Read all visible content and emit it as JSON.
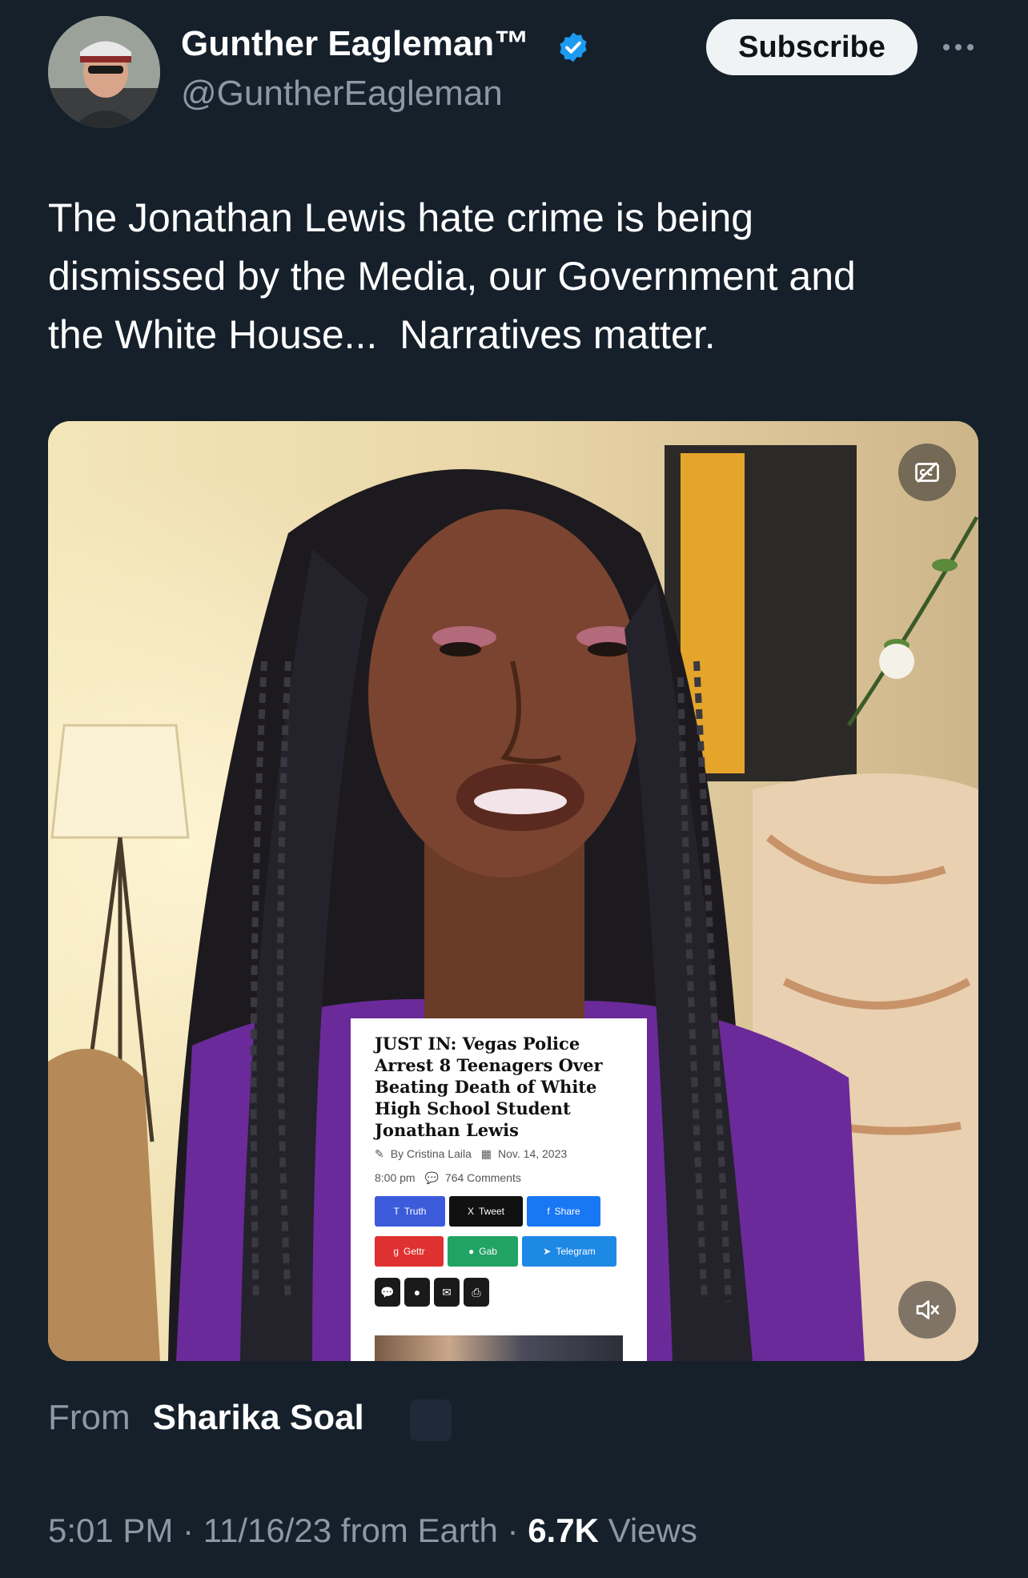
{
  "author": {
    "display_name": "Gunther Eagleman™",
    "handle": "@GuntherEagleman",
    "verified_icon": "verified-badge-icon",
    "badge_color": "#1d9bf0"
  },
  "actions": {
    "subscribe_label": "Subscribe",
    "more_icon": "more-horizontal-icon"
  },
  "tweet": {
    "lines": [
      "The Jonathan Lewis hate crime is being",
      "dismissed by the Media, our Government and",
      "the White House...  Narratives matter."
    ]
  },
  "media": {
    "article": {
      "headline": "JUST IN: Vegas Police Arrest 8 Teenagers Over Beating Death of White High School Student Jonathan Lewis",
      "byline": "By Cristina Laila",
      "date": "Nov. 14, 2023",
      "time": "8:00 pm",
      "comments": "764 Comments",
      "share_row1": [
        {
          "label": "Truth",
          "color": "#3b5bdb",
          "icon": "T"
        },
        {
          "label": "Tweet",
          "color": "#111111",
          "icon": "X"
        },
        {
          "label": "Share",
          "color": "#1877f2",
          "icon": "f"
        }
      ],
      "share_row2": [
        {
          "label": "Gettr",
          "color": "#e03131",
          "icon": "ɡ"
        },
        {
          "label": "Gab",
          "color": "#21a363",
          "icon": "●"
        },
        {
          "label": "Telegram",
          "color": "#1e88e5",
          "icon": "➤"
        }
      ],
      "mini_icons": [
        "💬",
        "●",
        "✉",
        "⎙"
      ]
    },
    "captions_icon": "closed-captions-icon",
    "mute_icon": "muted-speaker-icon"
  },
  "attribution": {
    "from_label": "From",
    "from_name": "Sharika Soal"
  },
  "meta": {
    "time": "5:01 PM",
    "sep1": " · ",
    "date": "11/16/23 from Earth",
    "sep2": " · ",
    "views_count": "6.7K",
    "views_label": " Views"
  }
}
